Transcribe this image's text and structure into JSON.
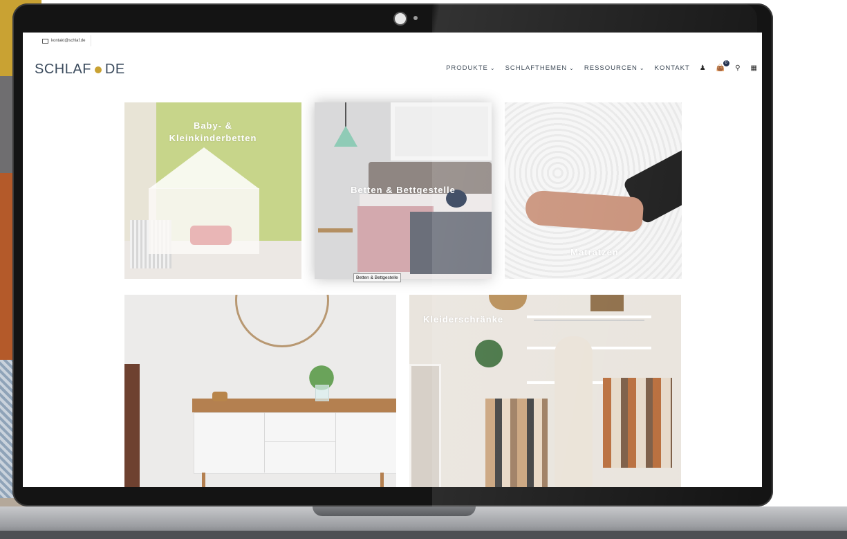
{
  "topbar": {
    "email": "kontakt@schlaf.de"
  },
  "logo": {
    "left": "SCHLAF",
    "right": "DE"
  },
  "nav": {
    "items": [
      {
        "label": "PRODUKTE",
        "has_dropdown": true
      },
      {
        "label": "SCHLAFTHEMEN",
        "has_dropdown": true
      },
      {
        "label": "RESSOURCEN",
        "has_dropdown": true
      },
      {
        "label": "KONTAKT",
        "has_dropdown": false
      }
    ],
    "icons": [
      "user-icon",
      "cart-icon",
      "search-icon",
      "grid-menu-icon"
    ],
    "cart_count": "0"
  },
  "categories": [
    {
      "title": "Baby- & Kleinkinderbetten"
    },
    {
      "title": "Betten & Bettgestelle"
    },
    {
      "title": "Matratzen"
    },
    {
      "title": ""
    },
    {
      "title": "Kleiderschränke"
    }
  ],
  "tooltip": "Betten & Bettgestelle",
  "colors": {
    "brand_navy": "#2d3a48",
    "brand_gold": "#c9a233",
    "badge": "#1c2b4a"
  }
}
